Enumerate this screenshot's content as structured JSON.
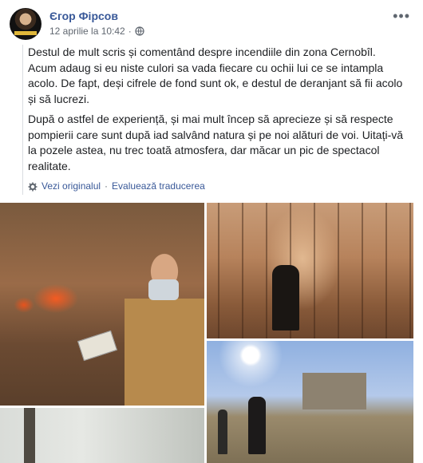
{
  "post": {
    "author": "Єгор Фірсов",
    "timestamp": "12 aprilie la 10:42",
    "separator": "·",
    "more_label": "•••",
    "paragraphs": [
      "Destul de mult scris și comentând despre incendiile din zona Cernobîl. Acum adaug si eu niste culori sa vada fiecare cu ochii lui ce se intampla acolo. De fapt, deși cifrele de fond sunt ok, e destul de deranjant să fii acolo și să lucrezi.",
      "După o astfel de experiență, și mai mult încep să aprecieze și să respecte pompierii care sunt după iad salvând natura și pe noi alături de voi. Uitați-vă la pozele astea, nu trec toată atmosfera, dar măcar un pic de spectacol realitate."
    ],
    "see_original": "Vezi originalul",
    "rate_translation": "Evaluează traducerea",
    "translate_separator": "·"
  },
  "icons": {
    "globe": "globe-icon",
    "gear": "gear-icon",
    "more": "more-icon"
  },
  "colors": {
    "link": "#385898",
    "meta": "#606770",
    "text": "#1c1e21"
  }
}
